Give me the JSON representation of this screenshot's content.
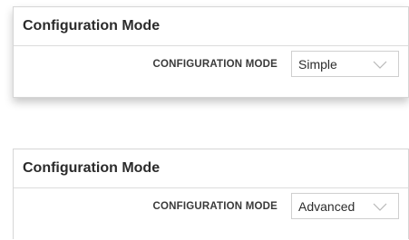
{
  "panels": [
    {
      "title": "Configuration Mode",
      "field_label": "CONFIGURATION MODE",
      "selected_value": "Simple"
    },
    {
      "title": "Configuration Mode",
      "field_label": "CONFIGURATION MODE",
      "selected_value": "Advanced"
    }
  ],
  "icons": {
    "dropdown": "chevron-down-icon"
  },
  "colors": {
    "border": "#d6d6d6",
    "title_text": "#2b2b2b",
    "chevron": "#b8b8b8"
  }
}
